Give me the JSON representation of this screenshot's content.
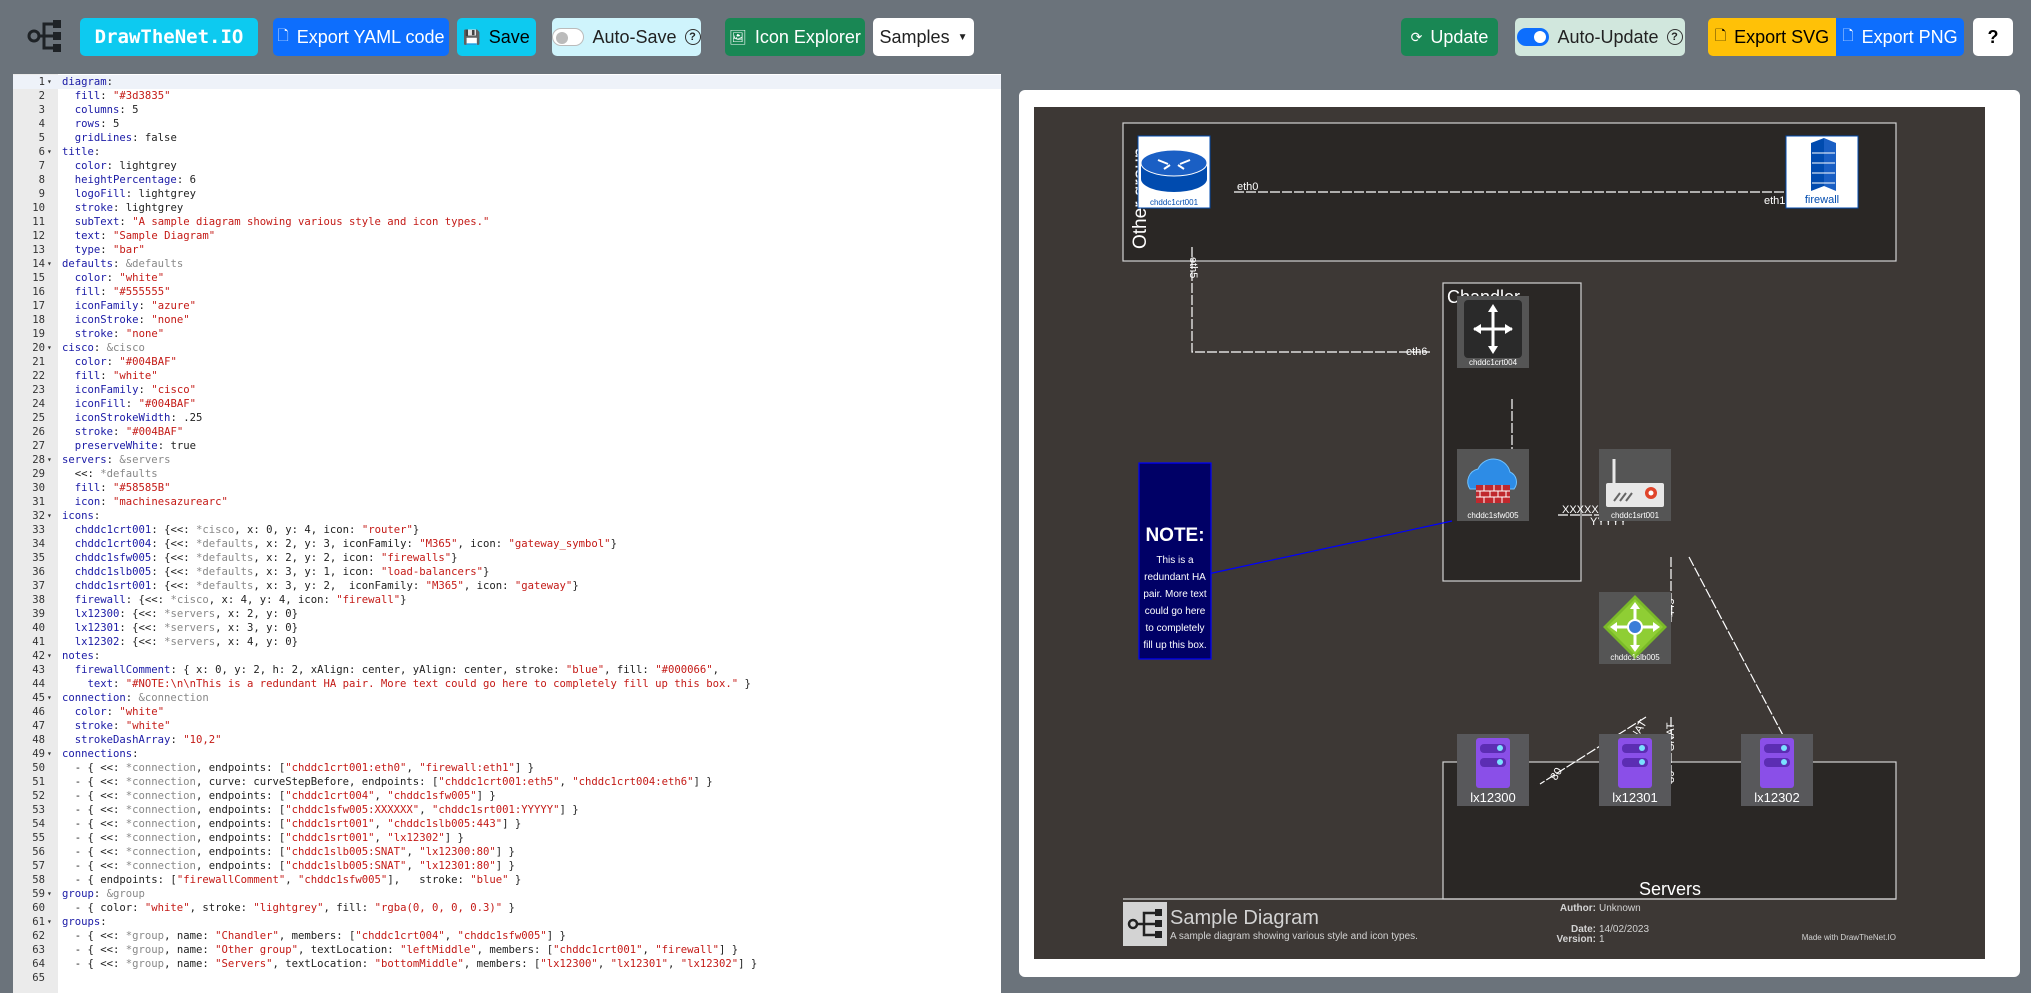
{
  "navbar": {
    "brand": "DrawTheNet.IO",
    "export_yaml": "Export YAML code",
    "save": "Save",
    "auto_save": "Auto-Save",
    "icon_explorer": "Icon Explorer",
    "samples": "Samples",
    "update": "Update",
    "auto_update": "Auto-Update",
    "export_svg": "Export SVG",
    "export_png": "Export PNG",
    "help": "?"
  },
  "colors": {
    "info": "#0dcaf0",
    "primary": "#0d6efd",
    "success": "#198754",
    "warning": "#ffc107",
    "diagram_fill": "#3d3835"
  },
  "editor": {
    "lines": [
      "diagram:",
      "  fill: \"#3d3835\"",
      "  columns: 5",
      "  rows: 5",
      "  gridLines: false",
      "title:",
      "  color: lightgrey",
      "  heightPercentage: 6",
      "  logoFill: lightgrey",
      "  stroke: lightgrey",
      "  subText: \"A sample diagram showing various style and icon types.\"",
      "  text: \"Sample Diagram\"",
      "  type: \"bar\"",
      "defaults: &defaults",
      "  color: \"white\"",
      "  fill: \"#555555\"",
      "  iconFamily: \"azure\"",
      "  iconStroke: \"none\"",
      "  stroke: \"none\"",
      "cisco: &cisco",
      "  color: \"#004BAF\"",
      "  fill: \"white\"",
      "  iconFamily: \"cisco\"",
      "  iconFill: \"#004BAF\"",
      "  iconStrokeWidth: .25",
      "  stroke: \"#004BAF\"",
      "  preserveWhite: true",
      "servers: &servers",
      "  <<: *defaults",
      "  fill: \"#58585B\"",
      "  icon: \"machinesazurearc\"",
      "icons:",
      "  chddc1crt001: {<<: *cisco, x: 0, y: 4, icon: \"router\"}",
      "  chddc1crt004: {<<: *defaults, x: 2, y: 3, iconFamily: \"M365\", icon: \"gateway_symbol\"}",
      "  chddc1sfw005: {<<: *defaults, x: 2, y: 2, icon: \"firewalls\"}",
      "  chddc1slb005: {<<: *defaults, x: 3, y: 1, icon: \"load-balancers\"}",
      "  chddc1srt001: {<<: *defaults, x: 3, y: 2,  iconFamily: \"M365\", icon: \"gateway\"}",
      "  firewall: {<<: *cisco, x: 4, y: 4, icon: \"firewall\"}",
      "  lx12300: {<<: *servers, x: 2, y: 0}",
      "  lx12301: {<<: *servers, x: 3, y: 0}",
      "  lx12302: {<<: *servers, x: 4, y: 0}",
      "notes:",
      "  firewallComment: { x: 0, y: 2, h: 2, xAlign: center, yAlign: center, stroke: \"blue\", fill: \"#000066\",",
      "    text: \"#NOTE:\\n\\nThis is a redundant HA pair. More text could go here to completely fill up this box.\" }",
      "connection: &connection",
      "  color: \"white\"",
      "  stroke: \"white\"",
      "  strokeDashArray: \"10,2\"",
      "connections:",
      "  - { <<: *connection, endpoints: [\"chddc1crt001:eth0\", \"firewall:eth1\"] }",
      "  - { <<: *connection, curve: curveStepBefore, endpoints: [\"chddc1crt001:eth5\", \"chddc1crt004:eth6\"] }",
      "  - { <<: *connection, endpoints: [\"chddc1crt004\", \"chddc1sfw005\"] }",
      "  - { <<: *connection, endpoints: [\"chddc1sfw005:XXXXXX\", \"chddc1srt001:YYYYY\"] }",
      "  - { <<: *connection, endpoints: [\"chddc1srt001\", \"chddc1slb005:443\"] }",
      "  - { <<: *connection, endpoints: [\"chddc1srt001\", \"lx12302\"] }",
      "  - { <<: *connection, endpoints: [\"chddc1slb005:SNAT\", \"lx12300:80\"] }",
      "  - { <<: *connection, endpoints: [\"chddc1slb005:SNAT\", \"lx12301:80\"] }",
      "  - { endpoints: [\"firewallComment\", \"chddc1sfw005\"],   stroke: \"blue\" }",
      "group: &group",
      "  - { color: \"white\", stroke: \"lightgrey\", fill: \"rgba(0, 0, 0, 0.3)\" }",
      "groups:",
      "  - { <<: *group, name: \"Chandler\", members: [\"chddc1crt004\", \"chddc1sfw005\"] }",
      "  - { <<: *group, name: \"Other group\", textLocation: \"leftMiddle\", members: [\"chddc1crt001\", \"firewall\"] }",
      "  - { <<: *group, name: \"Servers\", textLocation: \"bottomMiddle\", members: [\"lx12300\", \"lx12301\", \"lx12302\"] }",
      ""
    ]
  },
  "diagram": {
    "groups": {
      "other": "Other group",
      "chandler": "Chandler",
      "servers": "Servers"
    },
    "icons": {
      "crt001": "chddc1crt001",
      "firewall": "firewall",
      "crt004": "chddc1crt004",
      "sfw005": "chddc1sfw005",
      "srt001": "chddc1srt001",
      "slb005": "chddc1slb005",
      "lx12300": "lx12300",
      "lx12301": "lx12301",
      "lx12302": "lx12302"
    },
    "labels": {
      "eth0": "eth0",
      "eth1": "eth1",
      "eth5": "eth5",
      "eth6": "eth6",
      "xxxxxx": "XXXXXX",
      "yyyyy": "YYYYY",
      "p443": "443",
      "snat1": "SNAT",
      "snat2": "SNAT",
      "p80a": "80",
      "p80b": "80"
    },
    "note": {
      "heading": "NOTE:",
      "lines": [
        "This is a",
        "redundant HA",
        "pair. More text",
        "could go here",
        "to completely",
        "fill up this box."
      ]
    },
    "title": {
      "text": "Sample Diagram",
      "subtext": "A sample diagram showing various style and icon types.",
      "author_label": "Author:",
      "author": "Unknown",
      "date_label": "Date:",
      "date": "14/02/2023",
      "version_label": "Version:",
      "version": "1",
      "made_with": "Made with DrawTheNet.IO"
    }
  }
}
